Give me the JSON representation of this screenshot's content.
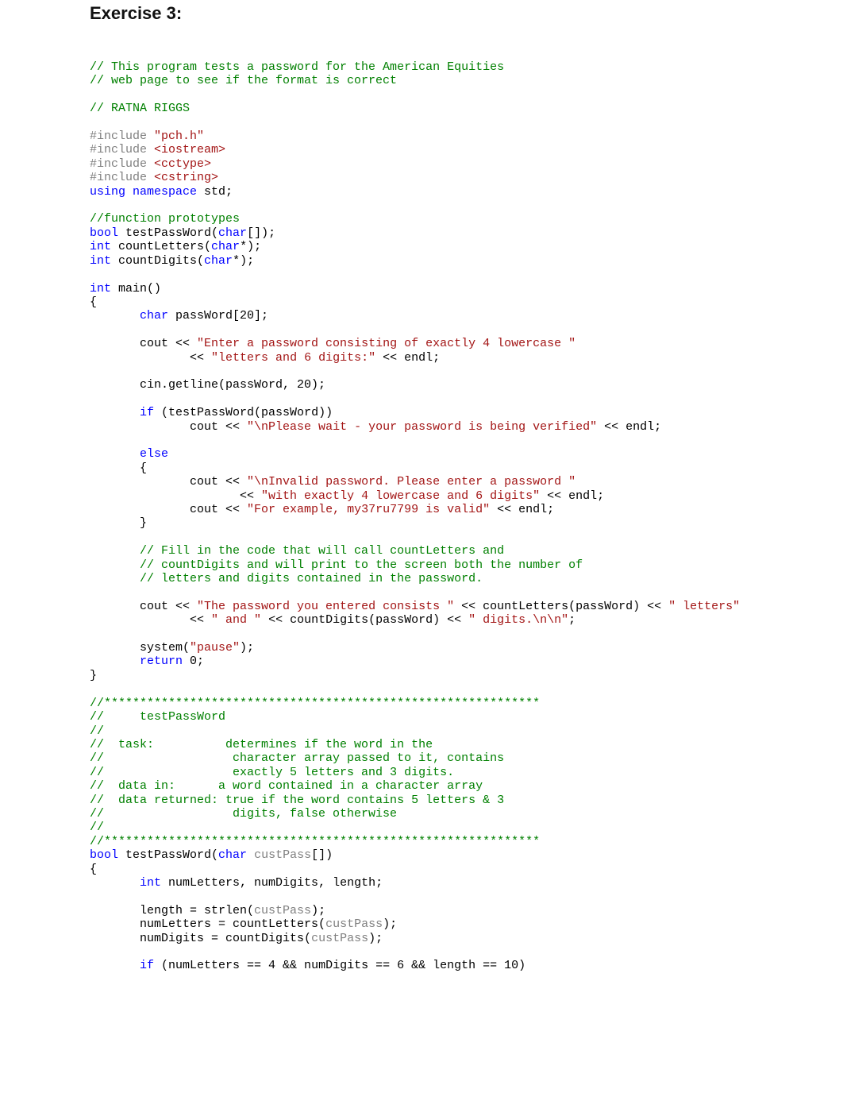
{
  "title": "Exercise 3:",
  "code": {
    "c1": "// This program tests a password for the American Equities",
    "c2": "// web page to see if the format is correct",
    "c3": "// RATNA RIGGS",
    "inc": "#include",
    "pch": "\"pch.h\"",
    "ios": "<iostream>",
    "cct": "<cctype>",
    "cst": "<cstring>",
    "using": "using",
    "namespace": "namespace",
    "std": " std;",
    "c4": "//function prototypes",
    "bool": "bool",
    "int": "int",
    "char": "char",
    "testPassWordDecl": " testPassWord(",
    "arrClose": "[]);",
    "countLettersDecl": " countLetters(",
    "countDigitsDecl": " countDigits(",
    "ptrClose": "*);",
    "mainDecl": " main()",
    "lbrace": "{",
    "rbrace": "}",
    "passWordDecl": " passWord[20];",
    "cout": "cout << ",
    "s1": "\"Enter a password consisting of exactly 4 lowercase \"",
    "s2": "\"letters and 6 digits:\"",
    "endl": " << endl;",
    "cont": "<< ",
    "cin": "cin.getline(passWord, 20);",
    "if": "if",
    "ifCond": " (testPassWord(passWord))",
    "s3": "\"\\nPlease wait - your password is being verified\"",
    "else": "else",
    "s4": "\"\\nInvalid password. Please enter a password \"",
    "s5": "\"with exactly 4 lowercase and 6 digits\"",
    "s6": "\"For example, my37ru7799 is valid\"",
    "c5": "// Fill in the code that will call countLetters and",
    "c6": "// countDigits and will print to the screen both the number of",
    "c7": "// letters and digits contained in the password.",
    "s7": "\"The password you entered consists \"",
    "mid1": " << countLetters(passWord) << ",
    "s8": "\" letters\"",
    "s9": "\" and \"",
    "mid2": " << countDigits(passWord) << ",
    "s10": "\" digits.\\n\\n\"",
    "semi": ";",
    "system": "system(",
    "pause": "\"pause\"",
    "closeParenSemi": ");",
    "return": "return",
    "zero": " 0;",
    "stars": "//*************************************************************",
    "c8": "//     testPassWord",
    "c9": "//",
    "c10": "//  task:          determines if the word in the",
    "c11": "//                  character array passed to it, contains",
    "c12": "//                  exactly 5 letters and 3 digits.",
    "c13": "//  data in:      a word contained in a character array",
    "c14": "//  data returned: true if the word contains 5 letters & 3",
    "c15": "//                  digits, false otherwise",
    "testPassWordDef": " testPassWord(",
    "custPass": "custPass",
    "arrCloseDef": "[])",
    "declLine": " numLetters, numDigits, length;",
    "lengthAssign": "length = strlen(",
    "closeParenSemi2": ");",
    "numLettersAssign": "numLetters = countLetters(",
    "numDigitsAssign": "numDigits = countDigits(",
    "ifCond2": " (numLetters == 4 && numDigits == 6 && length == 10)"
  }
}
